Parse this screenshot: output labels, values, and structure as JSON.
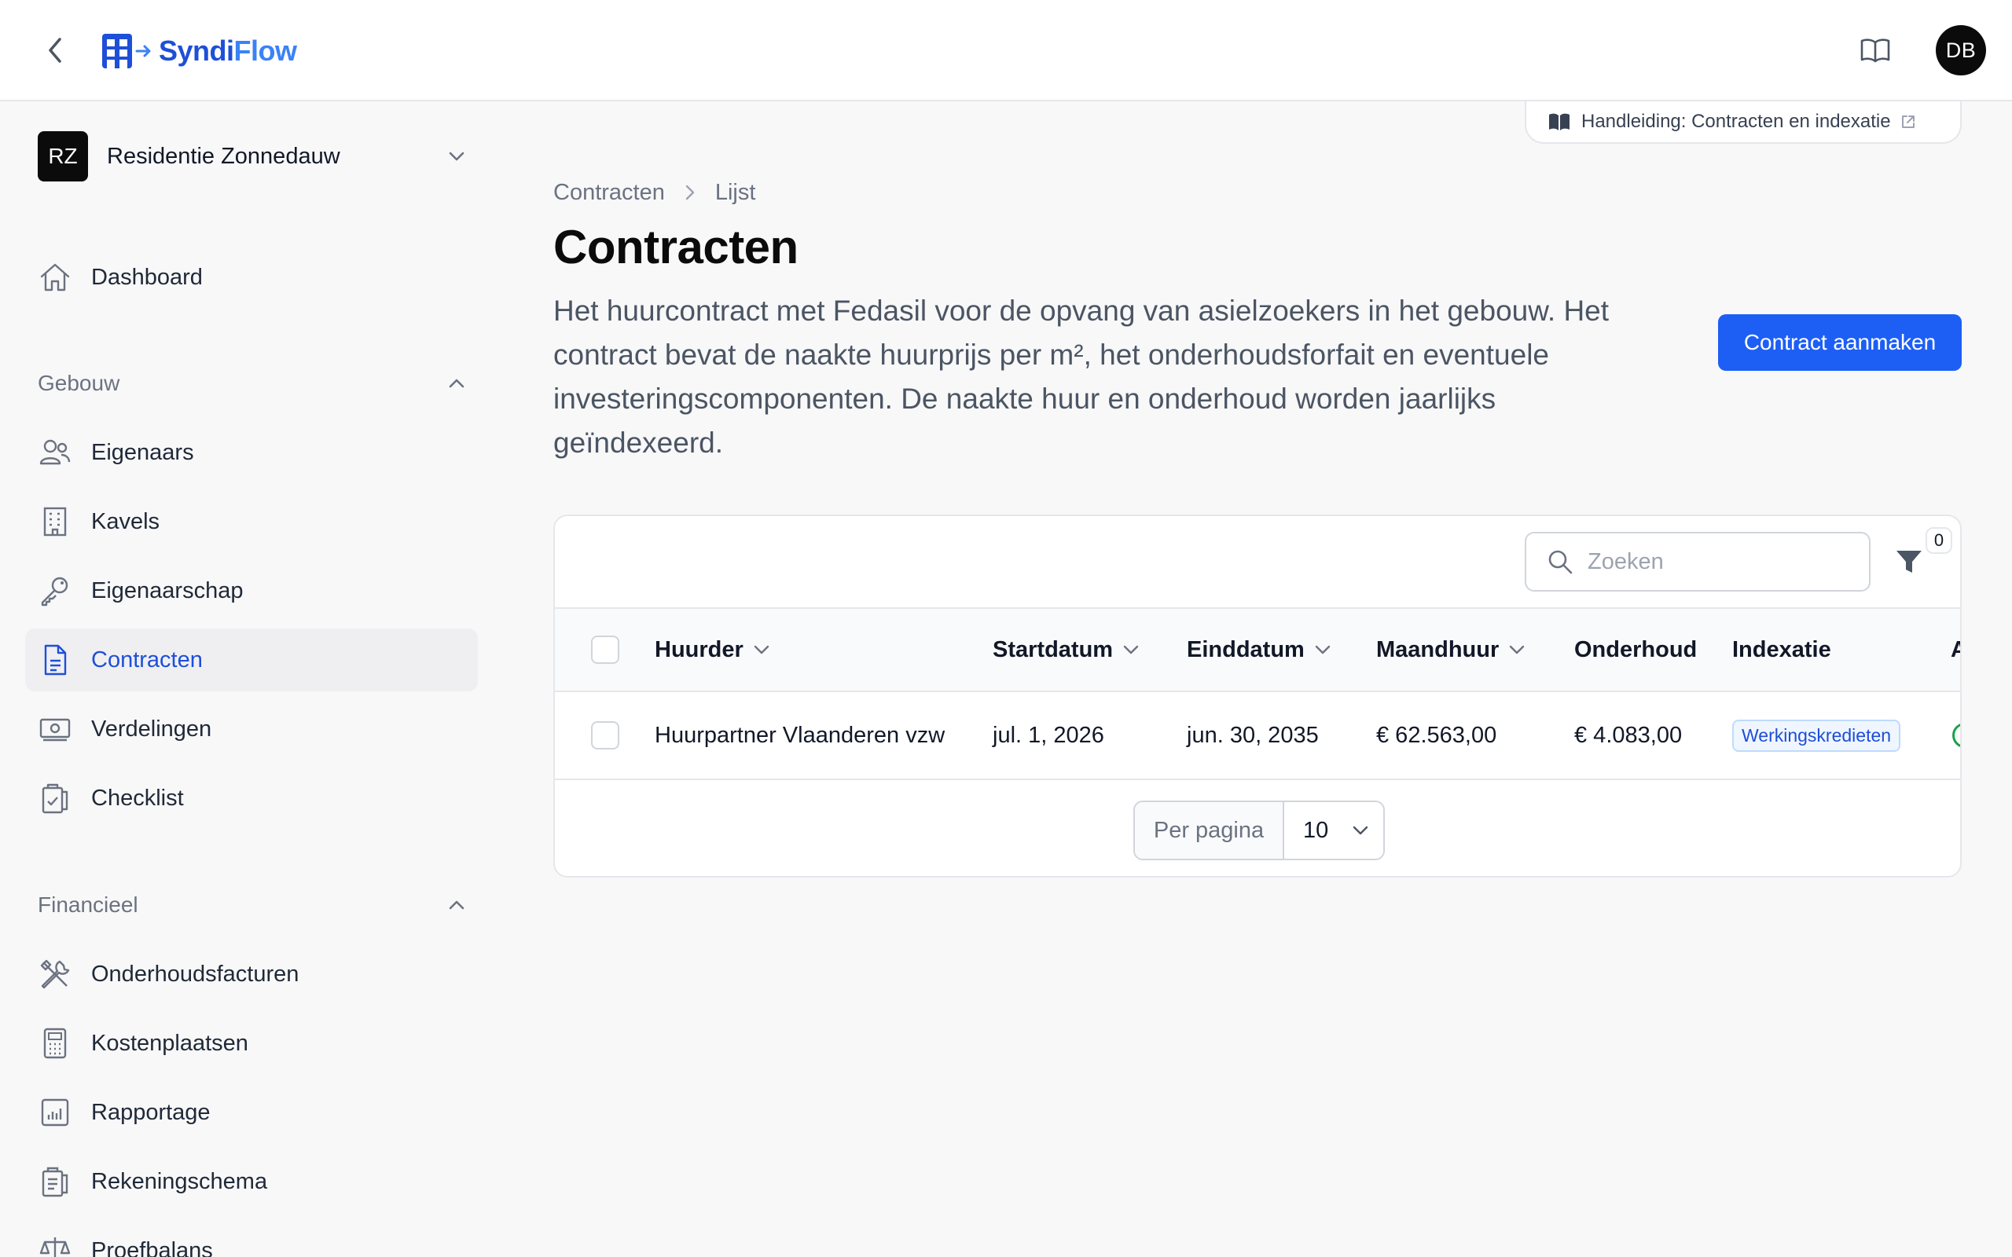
{
  "app": {
    "name_part1": "Syndi",
    "name_part2": "Flow"
  },
  "user": {
    "initials": "DB"
  },
  "org": {
    "initials": "RZ",
    "name": "Residentie Zonnedauw"
  },
  "sidebar": {
    "dashboard": {
      "label": "Dashboard",
      "icon": "home-icon"
    },
    "sections": [
      {
        "label": "Gebouw",
        "items": [
          {
            "label": "Eigenaars",
            "icon": "users-icon"
          },
          {
            "label": "Kavels",
            "icon": "building-icon"
          },
          {
            "label": "Eigenaarschap",
            "icon": "key-icon"
          },
          {
            "label": "Contracten",
            "icon": "document-icon",
            "active": true
          },
          {
            "label": "Verdelingen",
            "icon": "banknote-icon"
          },
          {
            "label": "Checklist",
            "icon": "clipboard-check-icon"
          }
        ]
      },
      {
        "label": "Financieel",
        "items": [
          {
            "label": "Onderhoudsfacturen",
            "icon": "tools-icon"
          },
          {
            "label": "Kostenplaatsen",
            "icon": "calculator-icon"
          },
          {
            "label": "Rapportage",
            "icon": "chart-icon"
          },
          {
            "label": "Rekeningschema",
            "icon": "clipboard-list-icon"
          },
          {
            "label": "Proefbalans",
            "icon": "scale-icon"
          }
        ]
      }
    ]
  },
  "guide": {
    "label": "Handleiding: Contracten en indexatie"
  },
  "breadcrumb": {
    "root": "Contracten",
    "current": "Lijst"
  },
  "page": {
    "title": "Contracten",
    "description": "Het huurcontract met Fedasil voor de opvang van asielzoekers in het gebouw. Het contract bevat de naakte huurprijs per m², het onderhoudsforfait en eventuele investeringscomponenten. De naakte huur en onderhoud worden jaarlijks geïndexeerd.",
    "create_button": "Contract aanmaken"
  },
  "table": {
    "search_placeholder": "Zoeken",
    "filter_count": "0",
    "columns": [
      "Huurder",
      "Startdatum",
      "Einddatum",
      "Maandhuur",
      "Onderhoud",
      "Indexatie",
      "A"
    ],
    "rows": [
      {
        "huurder": "Huurpartner Vlaanderen vzw",
        "startdatum": "jul. 1, 2026",
        "einddatum": "jun. 30, 2035",
        "maandhuur": "€ 62.563,00",
        "onderhoud": "€ 4.083,00",
        "indexatie": "Werkingskredieten"
      }
    ],
    "pager": {
      "label": "Per pagina",
      "value": "10"
    }
  },
  "colors": {
    "accent": "#1d5ff5",
    "active_text": "#1e4fd8",
    "status_green": "#16a34a"
  }
}
